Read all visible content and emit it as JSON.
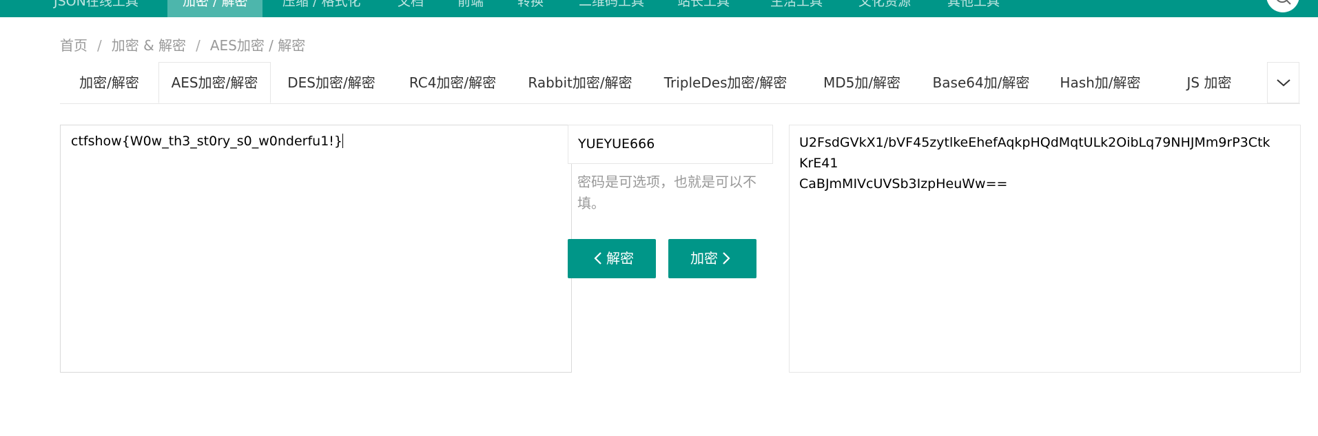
{
  "topnav": {
    "items": [
      "JSON在线工具",
      "加密 / 解密",
      "压缩 / 格式化",
      "文档",
      "前端",
      "转换",
      "二维码工具",
      "站长工具",
      "生活工具",
      "文化资源",
      "其他工具"
    ],
    "active_index": 1,
    "bg_color": "#009688"
  },
  "search": {
    "icon": "search-icon"
  },
  "breadcrumb": {
    "items": [
      "首页",
      "加密 & 解密",
      "AES加密 / 解密"
    ],
    "separator": "/"
  },
  "tabs": {
    "items": [
      "加密/解密",
      "AES加密/解密",
      "DES加密/解密",
      "RC4加密/解密",
      "Rabbit加密/解密",
      "TripleDes加密/解密",
      "MD5加/解密",
      "Base64加/解密",
      "Hash加/解密",
      "JS 加密"
    ],
    "active_index": 1,
    "more_icon": "chevron-down-icon"
  },
  "plaintext": {
    "value": "ctfshow{W0w_th3_st0ry_s0_w0nderfu1!}"
  },
  "key": {
    "value": "YUEYUE666",
    "hint": "密码是可选项，也就是可以不填。"
  },
  "buttons": {
    "decrypt_label": "解密",
    "encrypt_label": "加密",
    "color": "#009688"
  },
  "ciphertext": {
    "line1": "U2FsdGVkX1/bVF45zytlkeEhefAqkpHQdMqtULk2OibLq79NHJMm9rP3Ctk",
    "line2": "KrE41",
    "line3": "CaBJmMIVcUVSb3IzpHeuWw=="
  }
}
